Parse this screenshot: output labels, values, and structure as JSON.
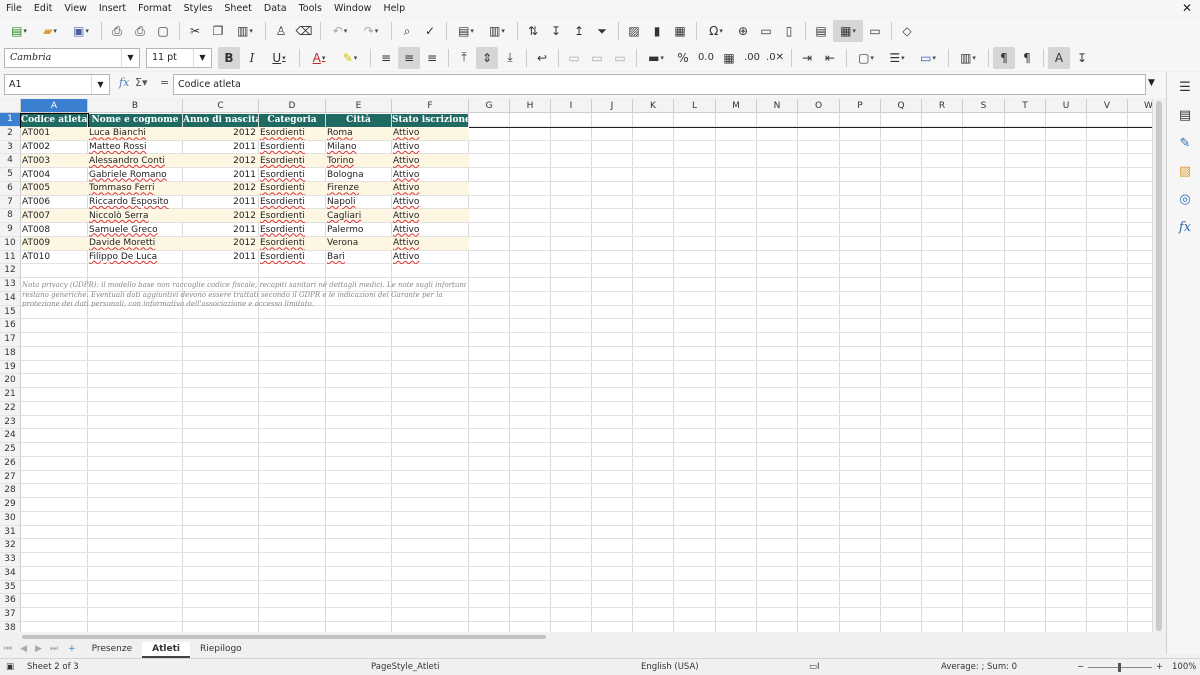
{
  "menu": [
    "File",
    "Edit",
    "View",
    "Insert",
    "Format",
    "Styles",
    "Sheet",
    "Data",
    "Tools",
    "Window",
    "Help"
  ],
  "font": {
    "name": "Cambria",
    "size": "11 pt"
  },
  "name_box": "A1",
  "formula": "Codice atleta",
  "columns": [
    "A",
    "B",
    "C",
    "D",
    "E",
    "F",
    "G",
    "H",
    "I",
    "J",
    "K",
    "L",
    "M",
    "N",
    "O",
    "P",
    "Q",
    "R",
    "S",
    "T",
    "U",
    "V",
    "W"
  ],
  "header_row": [
    "Codice atleta",
    "Nome e cognome",
    "Anno di nascita",
    "Categoria",
    "Città",
    "Stato iscrizione"
  ],
  "rows": [
    [
      "AT001",
      "Luca Bianchi",
      "2012",
      "Esordienti",
      "Roma",
      "Attivo"
    ],
    [
      "AT002",
      "Matteo Rossi",
      "2011",
      "Esordienti",
      "Milano",
      "Attivo"
    ],
    [
      "AT003",
      "Alessandro Conti",
      "2012",
      "Esordienti",
      "Torino",
      "Attivo"
    ],
    [
      "AT004",
      "Gabriele Romano",
      "2011",
      "Esordienti",
      "Bologna",
      "Attivo"
    ],
    [
      "AT005",
      "Tommaso Ferri",
      "2012",
      "Esordienti",
      "Firenze",
      "Attivo"
    ],
    [
      "AT006",
      "Riccardo Esposito",
      "2011",
      "Esordienti",
      "Napoli",
      "Attivo"
    ],
    [
      "AT007",
      "Niccolò Serra",
      "2012",
      "Esordienti",
      "Cagliari",
      "Attivo"
    ],
    [
      "AT008",
      "Samuele Greco",
      "2011",
      "Esordienti",
      "Palermo",
      "Attivo"
    ],
    [
      "AT009",
      "Davide Moretti",
      "2012",
      "Esordienti",
      "Verona",
      "Attivo"
    ],
    [
      "AT010",
      "Filippo De Luca",
      "2011",
      "Esordienti",
      "Bari",
      "Attivo"
    ]
  ],
  "note": "Nota privacy (GDPR): il modello base non raccoglie codice fiscale, recapiti sanitari né dettagli medici. Le note sugli infortuni restano generiche. Eventuali dati aggiuntivi devono essere trattati secondo il GDPR e le indicazioni del Garante per la protezione dei dati personali, con informativa dell'associazione e accesso limitato.",
  "sheet_tabs": [
    "Presenze",
    "Atleti",
    "Riepilogo"
  ],
  "status": {
    "sheet": "Sheet 2 of 3",
    "page_style": "PageStyle_Atleti",
    "language": "English (USA)",
    "summary": "Average: ; Sum: 0",
    "zoom": "100%"
  },
  "colors": {
    "header_bg": "#1f6b64",
    "band": "#fdf6e3",
    "selection": "#3b7fd1"
  }
}
